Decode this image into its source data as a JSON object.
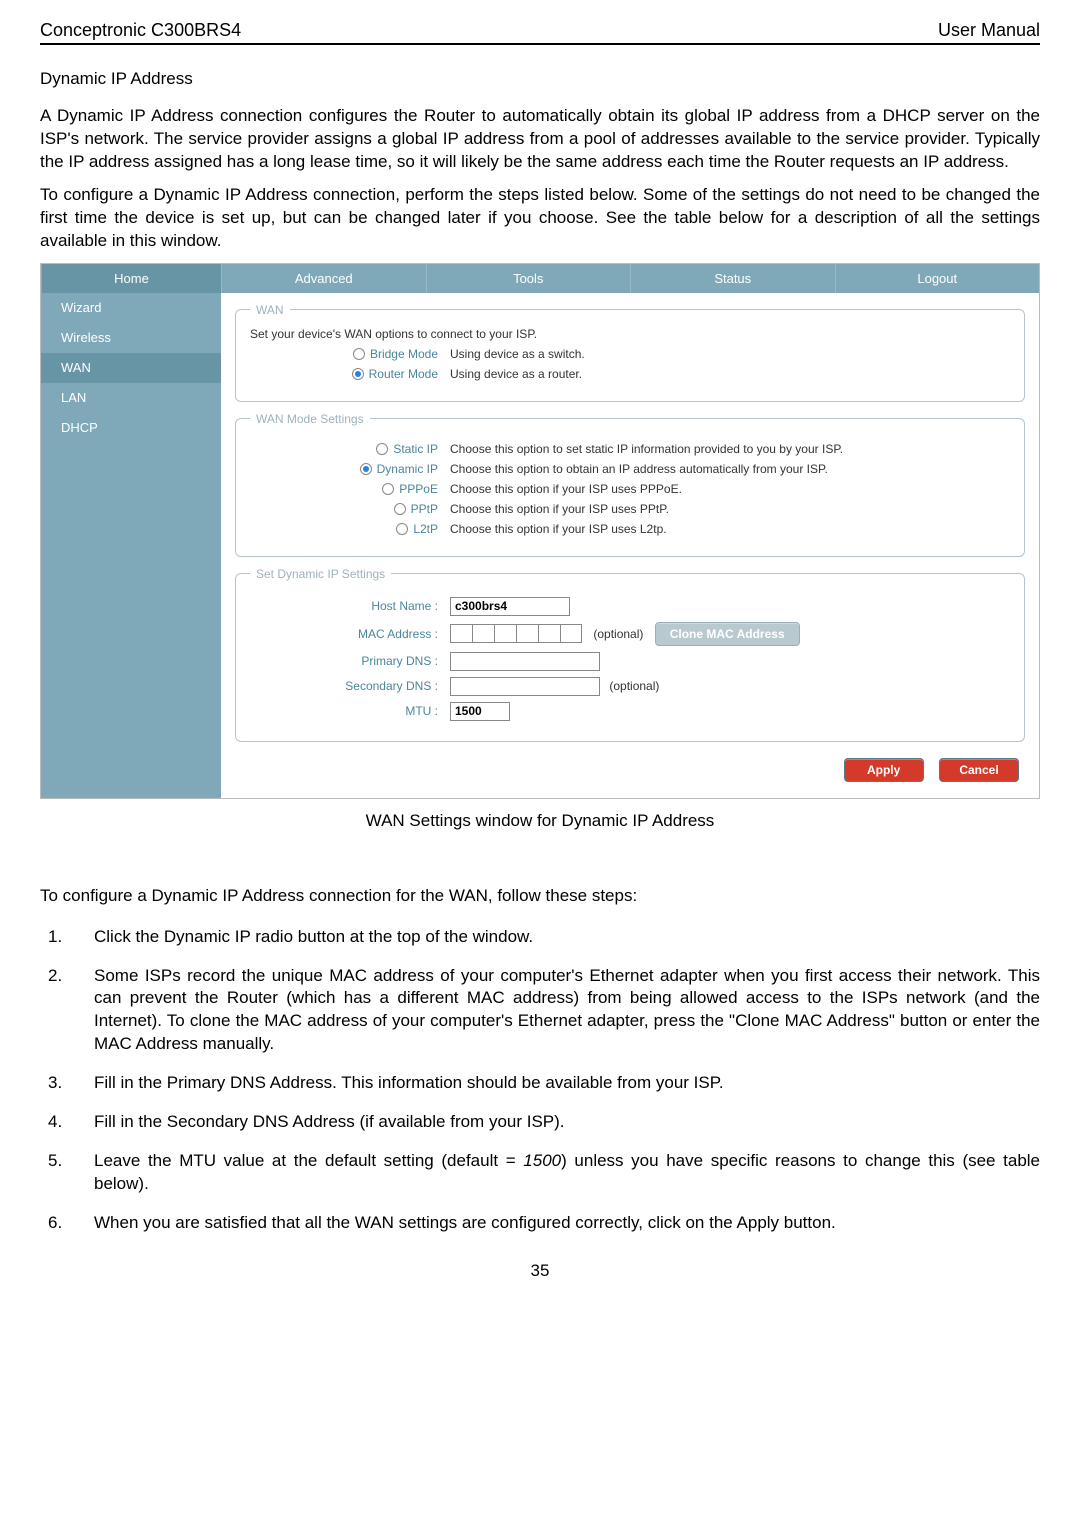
{
  "header": {
    "left": "Conceptronic C300BRS4",
    "right": "User Manual"
  },
  "title": "Dynamic IP Address",
  "para1": "A Dynamic IP Address connection configures the Router to automatically obtain its global IP address from a DHCP server on the ISP's network. The service provider assigns a global IP address from a pool of addresses available to the service provider. Typically the IP address assigned has a long lease time, so it will likely be the same address each time the Router requests an IP address.",
  "para2": "To configure a Dynamic IP Address connection, perform the steps listed below. Some of the settings do not need to be changed the first time the device is set up, but can be changed later if you choose. See the table below for a description of all the settings available in this window.",
  "router": {
    "tabs": {
      "home": "Home",
      "advanced": "Advanced",
      "tools": "Tools",
      "status": "Status",
      "logout": "Logout"
    },
    "sidebar": [
      "Wizard",
      "Wireless",
      "WAN",
      "LAN",
      "DHCP"
    ],
    "wan": {
      "legend": "WAN",
      "intro": "Set your device's WAN options to connect to your ISP.",
      "bridge_label": "Bridge Mode",
      "bridge_desc": "Using device as a switch.",
      "router_label": "Router Mode",
      "router_desc": "Using device as a router."
    },
    "wanmode": {
      "legend": "WAN Mode Settings",
      "static_label": "Static IP",
      "static_desc": "Choose this option to set static IP information provided to you by your ISP.",
      "dynamic_label": "Dynamic IP",
      "dynamic_desc": "Choose this option to obtain an IP address automatically from your ISP.",
      "pppoe_label": "PPPoE",
      "pppoe_desc": "Choose this option if your ISP uses PPPoE.",
      "pptp_label": "PPtP",
      "pptp_desc": "Choose this option if your ISP uses PPtP.",
      "l2tp_label": "L2tP",
      "l2tp_desc": "Choose this option if your ISP uses L2tp."
    },
    "dyn": {
      "legend": "Set Dynamic IP Settings",
      "host_label": "Host Name :",
      "host_value": "c300brs4",
      "mac_label": "MAC Address :",
      "mac_optional": "(optional)",
      "clone_btn": "Clone MAC Address",
      "pri_label": "Primary DNS :",
      "sec_label": "Secondary DNS :",
      "sec_optional": "(optional)",
      "mtu_label": "MTU :",
      "mtu_value": "1500"
    },
    "apply": "Apply",
    "cancel": "Cancel"
  },
  "caption": "WAN Settings window for Dynamic IP Address",
  "intro_steps": "To configure a Dynamic IP Address connection for the WAN, follow these steps:",
  "steps": [
    {
      "n": "1.",
      "t": "Click the Dynamic IP radio button at the top of the window."
    },
    {
      "n": "2.",
      "t": "Some ISPs record the unique MAC address of your computer's Ethernet adapter when you first access their network. This can prevent the Router (which has a different MAC address) from being allowed access to the ISPs network (and the Internet). To clone the MAC address of your computer's Ethernet adapter, press the \"Clone MAC Address\" button or enter the MAC Address manually."
    },
    {
      "n": "3.",
      "t": "Fill in the Primary DNS Address. This information should be available from your ISP."
    },
    {
      "n": "4.",
      "t": "Fill in the Secondary DNS Address (if available from your ISP)."
    },
    {
      "n": "5.",
      "t_pre": "Leave the MTU value at the default setting (default = ",
      "t_em": "1500",
      "t_post": ") unless you have specific reasons to change this (see table below)."
    },
    {
      "n": "6.",
      "t": "When you are satisfied that all the WAN settings are configured correctly, click on the Apply button."
    }
  ],
  "page_number": "35"
}
